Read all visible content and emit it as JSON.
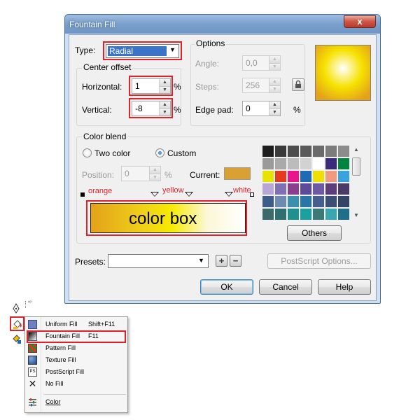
{
  "dialog": {
    "title": "Fountain Fill",
    "close_glyph": "x",
    "type_label": "Type:",
    "type_value": "Radial",
    "center_offset": {
      "group_label": "Center offset",
      "horizontal_label": "Horizontal:",
      "horizontal_value": "1",
      "vertical_label": "Vertical:",
      "vertical_value": "-8",
      "unit": "%"
    },
    "options": {
      "group_label": "Options",
      "angle_label": "Angle:",
      "angle_value": "0,0",
      "steps_label": "Steps:",
      "steps_value": "256",
      "edge_pad_label": "Edge pad:",
      "edge_pad_value": "0",
      "unit": "%"
    },
    "preview_colors": {
      "center": "#ffffff",
      "mid": "#f6e200",
      "outer": "#e3a21a"
    },
    "color_blend": {
      "group_label": "Color blend",
      "two_color_label": "Two color",
      "custom_label": "Custom",
      "selected": "custom",
      "position_label": "Position:",
      "position_value": "0",
      "unit": "%",
      "current_label": "Current:",
      "current_color": "#d9a033",
      "gradient_text": "color box",
      "stop_labels": {
        "orange": "orange",
        "yellow": "yellow",
        "white": "white"
      },
      "gradient_colors": [
        "#e3a21a",
        "#f0d218",
        "#f7ea00",
        "#fbf7d6",
        "#ffffff"
      ],
      "palette": [
        "#1e1e1e",
        "#3a3a3a",
        "#4d4d4d",
        "#5a5a5a",
        "#6b6b6b",
        "#7c7c7c",
        "#8c8c8c",
        "#9a9a9a",
        "#aaaaaa",
        "#bcbcbc",
        "#d2d2d2",
        "#ffffff",
        "#3a2b7a",
        "#00843e",
        "#e8e200",
        "#e33b1c",
        "#e9158a",
        "#1f6ab4",
        "#f0e000",
        "#f29a80",
        "#3aa2dc",
        "#b8a7d4",
        "#7f6fb3",
        "#8a3e8e",
        "#5e4a9a",
        "#6e5aa4",
        "#5c3f7a",
        "#4a3a66",
        "#3c5c8a",
        "#6f8ab0",
        "#3d8fb0",
        "#2a75a8",
        "#465e8c",
        "#3d4e74",
        "#334466",
        "#3a6a6a",
        "#2f6f6f",
        "#1f8f8f",
        "#1aa0a0",
        "#3c7a7a",
        "#3aa6b0",
        "#1f6f8a"
      ],
      "others_label": "Others"
    },
    "presets_label": "Presets:",
    "presets_value": "",
    "postscript_label": "PostScript Options...",
    "ok_label": "OK",
    "cancel_label": "Cancel",
    "help_label": "Help"
  },
  "toolbar": {
    "icons": [
      "pen-icon",
      "fill-icon",
      "interactive-fill-icon"
    ]
  },
  "menu": {
    "items": [
      {
        "label": "Uniform Fill",
        "shortcut": "Shift+F11",
        "icon": "uniform-fill-icon"
      },
      {
        "label": "Fountain Fill",
        "shortcut": "F11",
        "icon": "fountain-fill-icon"
      },
      {
        "label": "Pattern Fill",
        "shortcut": "",
        "icon": "pattern-fill-icon"
      },
      {
        "label": "Texture Fill",
        "shortcut": "",
        "icon": "texture-fill-icon"
      },
      {
        "label": "PostScript Fill",
        "shortcut": "",
        "icon": "postscript-fill-icon"
      },
      {
        "label": "No Fill",
        "shortcut": "",
        "icon": "no-fill-icon"
      },
      {
        "label": "Color",
        "shortcut": "",
        "icon": "color-icon"
      }
    ]
  }
}
